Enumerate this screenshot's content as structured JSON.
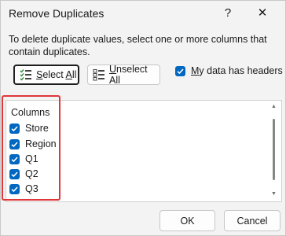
{
  "dialog": {
    "title": "Remove Duplicates",
    "help_label": "?",
    "close_label": "✕",
    "instructions": "To delete duplicate values, select one or more columns that contain duplicates."
  },
  "buttons": {
    "select_all_prefix": "",
    "select_all_u": "S",
    "select_all_rest": "elect ",
    "select_all_u2": "A",
    "select_all_rest2": "ll",
    "unselect_all_u": "U",
    "unselect_all_rest": "nselect All",
    "ok": "OK",
    "cancel": "Cancel"
  },
  "headers_checkbox": {
    "label_u": "M",
    "label_rest": "y data has headers",
    "checked": true
  },
  "columns_list": {
    "header": "Columns",
    "items": [
      {
        "label": "Store",
        "checked": true
      },
      {
        "label": "Region",
        "checked": true
      },
      {
        "label": "Q1",
        "checked": true
      },
      {
        "label": "Q2",
        "checked": true
      },
      {
        "label": "Q3",
        "checked": true
      }
    ]
  },
  "colors": {
    "accent": "#0067c0",
    "highlight": "#e0373a"
  },
  "icons": {
    "select_all": "select-all-icon",
    "unselect_all": "unselect-all-icon",
    "check": "checkmark-icon"
  }
}
